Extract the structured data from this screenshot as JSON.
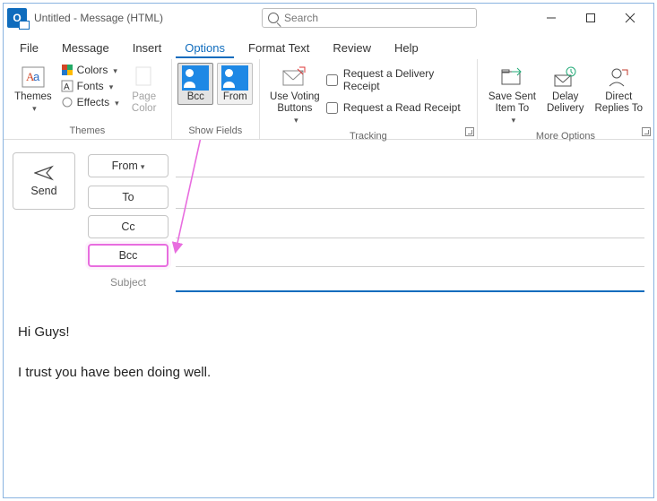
{
  "window": {
    "title": "Untitled  -  Message (HTML)",
    "search_placeholder": "Search"
  },
  "menu": {
    "file": "File",
    "message": "Message",
    "insert": "Insert",
    "options": "Options",
    "format_text": "Format Text",
    "review": "Review",
    "help": "Help"
  },
  "ribbon": {
    "themes": {
      "label": "Themes",
      "themes_btn": "Themes",
      "colors": "Colors",
      "fonts": "Fonts",
      "effects": "Effects",
      "page_color": "Page\nColor"
    },
    "show_fields": {
      "label": "Show Fields",
      "bcc": "Bcc",
      "from": "From"
    },
    "tracking": {
      "label": "Tracking",
      "voting": "Use Voting\nButtons",
      "delivery": "Request a Delivery Receipt",
      "read": "Request a Read Receipt"
    },
    "more_options": {
      "label": "More Options",
      "save_sent": "Save Sent\nItem To",
      "delay": "Delay\nDelivery",
      "direct": "Direct\nReplies To"
    }
  },
  "compose": {
    "send": "Send",
    "from": "From",
    "to": "To",
    "cc": "Cc",
    "bcc": "Bcc",
    "subject": "Subject",
    "fields": {
      "from": "",
      "to": "",
      "cc": "",
      "bcc": "",
      "subject": ""
    },
    "body_p1": "Hi Guys!",
    "body_p2": "I trust you have been doing well."
  }
}
